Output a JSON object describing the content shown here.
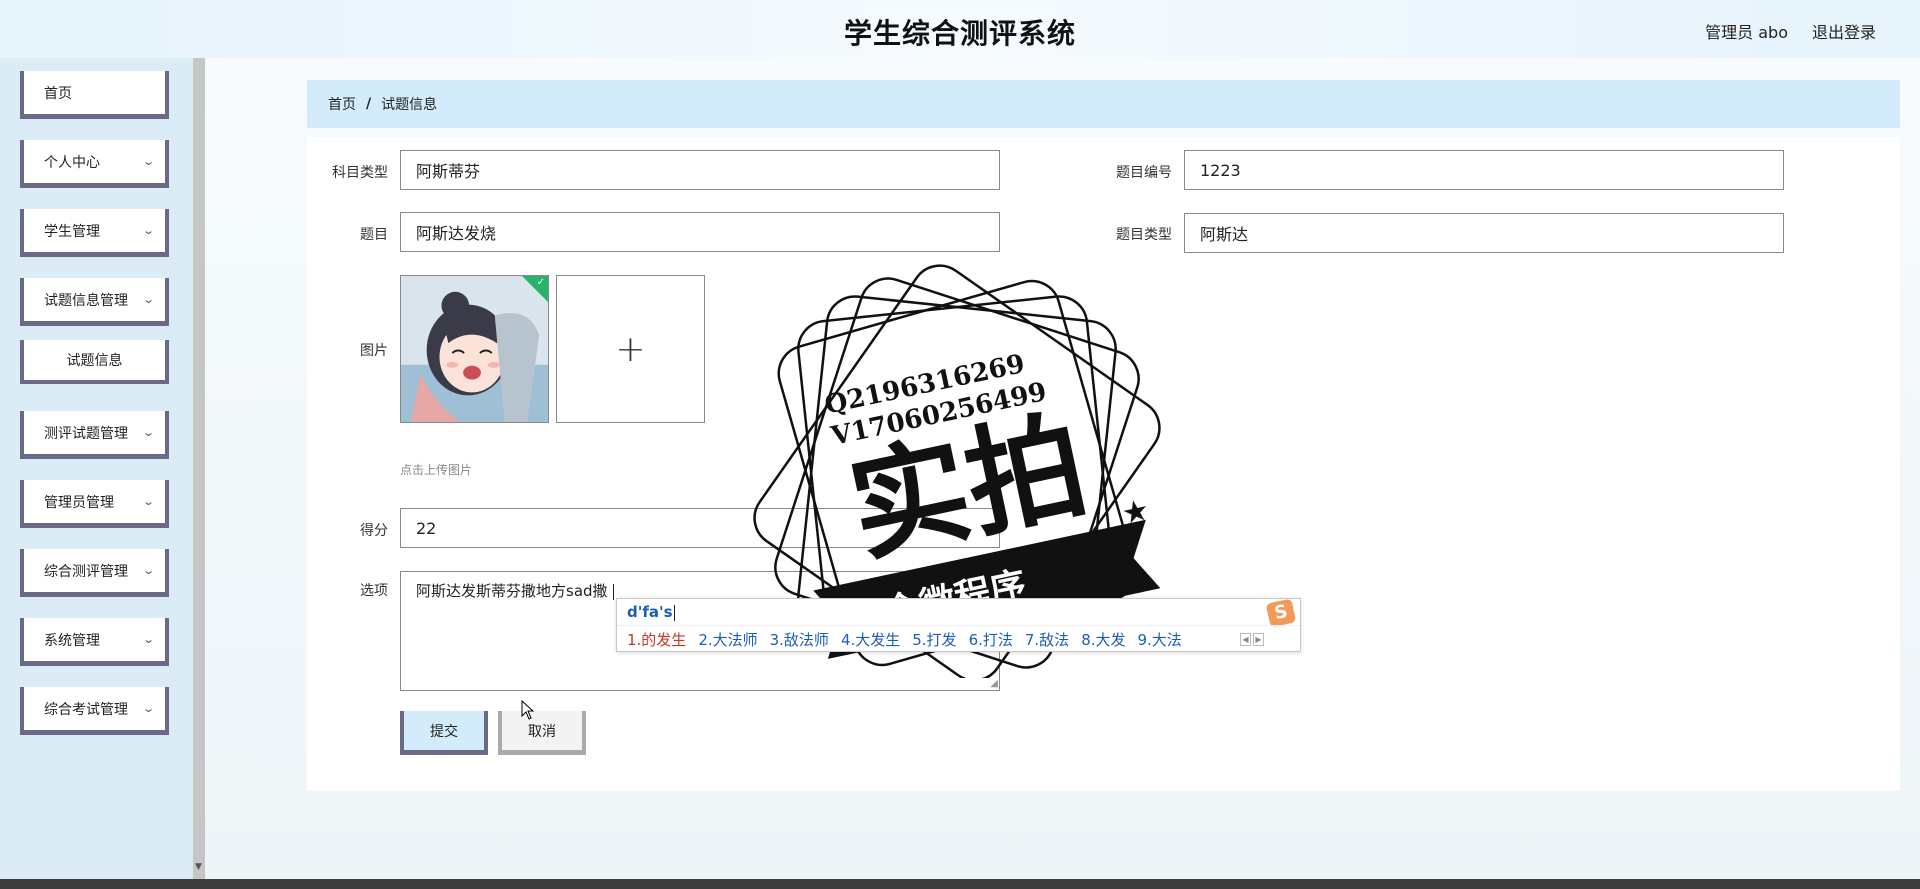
{
  "header": {
    "title": "学生综合测评系统",
    "user_label": "管理员 abo",
    "logout_label": "退出登录"
  },
  "sidebar": {
    "items": [
      {
        "label": "首页"
      },
      {
        "label": "个人中心"
      },
      {
        "label": "学生管理"
      },
      {
        "label": "试题信息管理"
      },
      {
        "label": "试题信息"
      },
      {
        "label": "测评试题管理"
      },
      {
        "label": "管理员管理"
      },
      {
        "label": "综合测评管理"
      },
      {
        "label": "系统管理"
      },
      {
        "label": "综合考试管理"
      }
    ]
  },
  "breadcrumb": {
    "home": "首页",
    "separator": "/",
    "current": "试题信息"
  },
  "form": {
    "subject_type_label": "科目类型",
    "subject_type_value": "阿斯蒂芬",
    "question_no_label": "题目编号",
    "question_no_value": "1223",
    "question_label": "题目",
    "question_value": "阿斯达发烧",
    "question_type_label": "题目类型",
    "question_type_value": "阿斯达",
    "image_label": "图片",
    "upload_plus": "+",
    "upload_hint": "点击上传图片",
    "score_label": "得分",
    "score_value": "22",
    "options_label": "选项",
    "options_value": "阿斯达发斯蒂芬撒地方sad撒 ",
    "submit_label": "提交",
    "cancel_label": "取消"
  },
  "ime": {
    "composition": "d'fa's",
    "logo": "S",
    "candidates": [
      "1.的发生",
      "2.大法师",
      "3.敌法师",
      "4.大发生",
      "5.打发",
      "6.打法",
      "7.敌法",
      "8.大发",
      "9.大法"
    ]
  },
  "watermark": {
    "contact_line1": "Q2196316269",
    "contact_line2": "V17060256499",
    "main_text": "实拍",
    "ribbon_text": "全微程序"
  },
  "colors": {
    "accent": "#d3ebfa",
    "border_dark": "#6a6a88",
    "success": "#26b56a"
  }
}
